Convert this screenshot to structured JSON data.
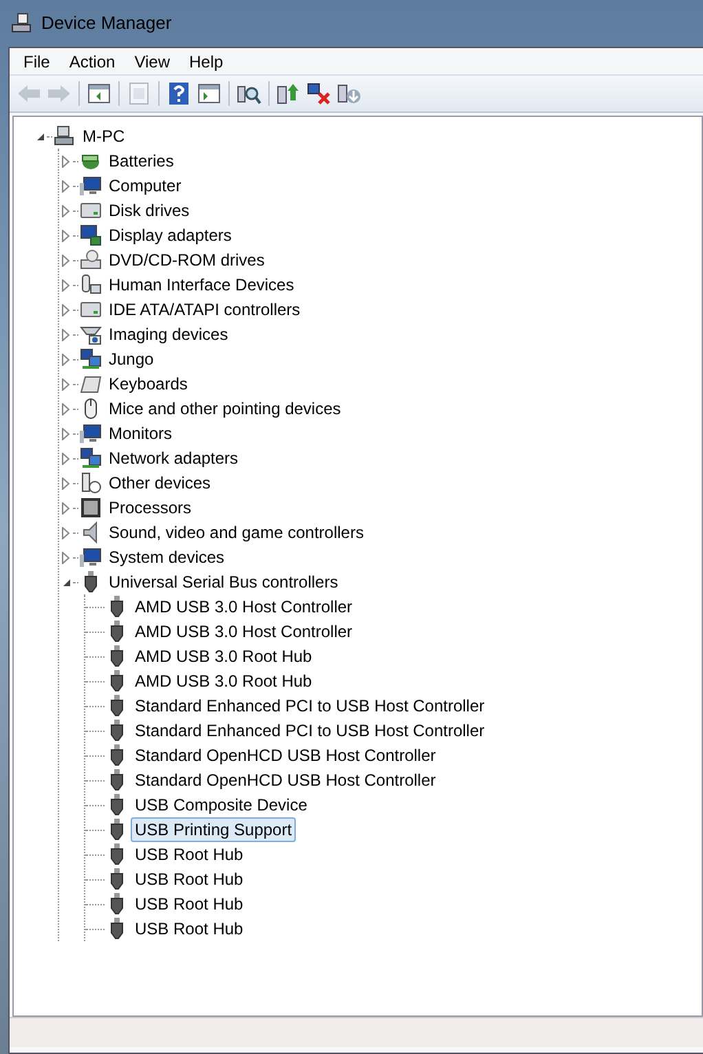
{
  "window": {
    "title": "Device Manager"
  },
  "menu": [
    {
      "label": "File"
    },
    {
      "label": "Action"
    },
    {
      "label": "View"
    },
    {
      "label": "Help"
    }
  ],
  "toolbar": [
    {
      "kind": "back",
      "disabled": true
    },
    {
      "kind": "forward",
      "disabled": true
    },
    {
      "kind": "sep"
    },
    {
      "kind": "console"
    },
    {
      "kind": "sep"
    },
    {
      "kind": "properties",
      "disabled": true
    },
    {
      "kind": "sep"
    },
    {
      "kind": "help"
    },
    {
      "kind": "pane"
    },
    {
      "kind": "sep"
    },
    {
      "kind": "scan"
    },
    {
      "kind": "sep"
    },
    {
      "kind": "update"
    },
    {
      "kind": "uninstall"
    },
    {
      "kind": "disable"
    }
  ],
  "tree": [
    {
      "label": "M-PC",
      "kind": "computer",
      "expanded": true,
      "selected": false,
      "children": [
        {
          "label": "Batteries",
          "kind": "battery",
          "expanded": false,
          "selected": false
        },
        {
          "label": "Computer",
          "kind": "monitor",
          "expanded": false,
          "selected": false
        },
        {
          "label": "Disk drives",
          "kind": "disk",
          "expanded": false,
          "selected": false
        },
        {
          "label": "Display adapters",
          "kind": "display",
          "expanded": false,
          "selected": false
        },
        {
          "label": "DVD/CD-ROM drives",
          "kind": "dvd",
          "expanded": false,
          "selected": false
        },
        {
          "label": "Human Interface Devices",
          "kind": "hid",
          "expanded": false,
          "selected": false
        },
        {
          "label": "IDE ATA/ATAPI controllers",
          "kind": "disk",
          "expanded": false,
          "selected": false
        },
        {
          "label": "Imaging devices",
          "kind": "imaging",
          "expanded": false,
          "selected": false
        },
        {
          "label": "Jungo",
          "kind": "network",
          "expanded": false,
          "selected": false
        },
        {
          "label": "Keyboards",
          "kind": "keyboard",
          "expanded": false,
          "selected": false
        },
        {
          "label": "Mice and other pointing devices",
          "kind": "mouse",
          "expanded": false,
          "selected": false
        },
        {
          "label": "Monitors",
          "kind": "monitor",
          "expanded": false,
          "selected": false
        },
        {
          "label": "Network adapters",
          "kind": "network",
          "expanded": false,
          "selected": false
        },
        {
          "label": "Other devices",
          "kind": "other",
          "expanded": false,
          "selected": false
        },
        {
          "label": "Processors",
          "kind": "processor",
          "expanded": false,
          "selected": false
        },
        {
          "label": "Sound, video and game controllers",
          "kind": "sound",
          "expanded": false,
          "selected": false
        },
        {
          "label": "System devices",
          "kind": "monitor",
          "expanded": false,
          "selected": false
        },
        {
          "label": "Universal Serial Bus controllers",
          "kind": "usb",
          "expanded": true,
          "selected": false,
          "children": [
            {
              "label": "AMD USB 3.0 Host Controller",
              "kind": "usb",
              "selected": false
            },
            {
              "label": "AMD USB 3.0 Host Controller",
              "kind": "usb",
              "selected": false
            },
            {
              "label": "AMD USB 3.0 Root Hub",
              "kind": "usb",
              "selected": false
            },
            {
              "label": "AMD USB 3.0 Root Hub",
              "kind": "usb",
              "selected": false
            },
            {
              "label": "Standard Enhanced PCI to USB Host Controller",
              "kind": "usb",
              "selected": false
            },
            {
              "label": "Standard Enhanced PCI to USB Host Controller",
              "kind": "usb",
              "selected": false
            },
            {
              "label": "Standard OpenHCD USB Host Controller",
              "kind": "usb",
              "selected": false
            },
            {
              "label": "Standard OpenHCD USB Host Controller",
              "kind": "usb",
              "selected": false
            },
            {
              "label": "USB Composite Device",
              "kind": "usb",
              "selected": false
            },
            {
              "label": "USB Printing Support",
              "kind": "usb",
              "selected": true
            },
            {
              "label": "USB Root Hub",
              "kind": "usb",
              "selected": false
            },
            {
              "label": "USB Root Hub",
              "kind": "usb",
              "selected": false
            },
            {
              "label": "USB Root Hub",
              "kind": "usb",
              "selected": false
            },
            {
              "label": "USB Root Hub",
              "kind": "usb",
              "selected": false
            }
          ]
        }
      ]
    }
  ]
}
